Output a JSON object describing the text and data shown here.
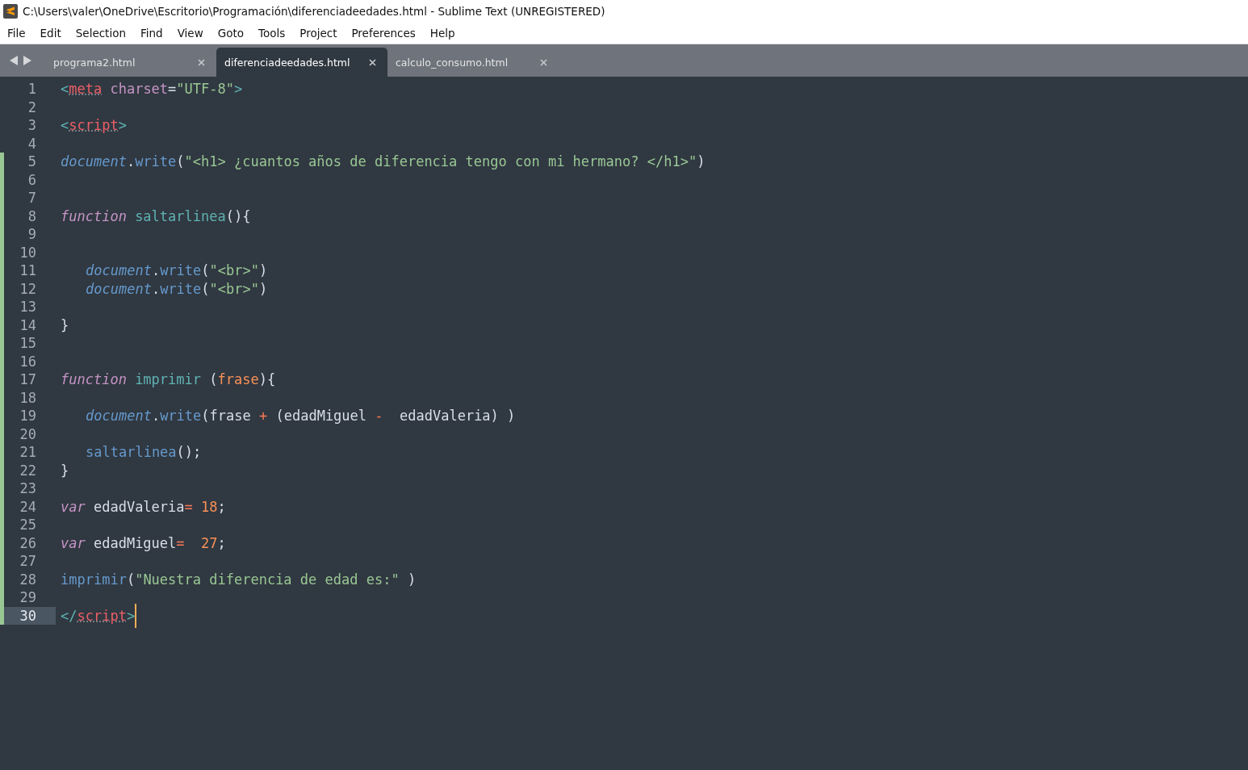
{
  "window": {
    "title": "C:\\Users\\valer\\OneDrive\\Escritorio\\Programación\\diferenciadeedades.html - Sublime Text (UNREGISTERED)"
  },
  "menu": [
    "File",
    "Edit",
    "Selection",
    "Find",
    "View",
    "Goto",
    "Tools",
    "Project",
    "Preferences",
    "Help"
  ],
  "tabs": [
    {
      "label": "programa2.html",
      "selected": false
    },
    {
      "label": "diferenciadeedades.html",
      "selected": true
    },
    {
      "label": "calculo_consumo.html",
      "selected": false
    }
  ],
  "lines": [
    {
      "number": "1",
      "modified": false,
      "current": false,
      "indented": false,
      "tokens": [
        {
          "kind": "tag",
          "text": "<"
        },
        {
          "kind": "tagname",
          "text": "meta"
        },
        {
          "kind": "attr",
          "text": " charset"
        },
        {
          "kind": "plain",
          "text": "="
        },
        {
          "kind": "string",
          "text": "\"UTF-8\""
        },
        {
          "kind": "tag",
          "text": ">"
        }
      ]
    },
    {
      "number": "2",
      "modified": false,
      "current": false,
      "indented": false
    },
    {
      "number": "3",
      "modified": false,
      "current": false,
      "indented": false,
      "tokens": [
        {
          "kind": "tag",
          "text": "<"
        },
        {
          "kind": "tagname",
          "text": "script"
        },
        {
          "kind": "tag",
          "text": ">"
        }
      ]
    },
    {
      "number": "4",
      "modified": false,
      "current": false,
      "indented": false
    },
    {
      "number": "5",
      "modified": true,
      "current": false,
      "indented": false,
      "tokens": [
        {
          "kind": "builtin",
          "text": "document"
        },
        {
          "kind": "plain",
          "text": "."
        },
        {
          "kind": "method",
          "text": "write"
        },
        {
          "kind": "plain",
          "text": "("
        },
        {
          "kind": "string",
          "text": "\"<h1> ¿cuantos años de diferencia tengo con mi hermano? </h1>\""
        },
        {
          "kind": "plain",
          "text": ")"
        }
      ]
    },
    {
      "number": "6",
      "modified": true,
      "current": false,
      "indented": false
    },
    {
      "number": "7",
      "modified": true,
      "current": false,
      "indented": false
    },
    {
      "number": "8",
      "modified": true,
      "current": false,
      "indented": false,
      "tokens": [
        {
          "kind": "keyword",
          "text": "function"
        },
        {
          "kind": "func",
          "text": " saltarlinea"
        },
        {
          "kind": "plain",
          "text": "(){"
        }
      ]
    },
    {
      "number": "9",
      "modified": true,
      "current": false,
      "indented": false
    },
    {
      "number": "10",
      "modified": true,
      "current": false,
      "indented": false
    },
    {
      "number": "11",
      "modified": true,
      "current": false,
      "indented": true,
      "tokens": [
        {
          "kind": "builtin",
          "text": "document"
        },
        {
          "kind": "plain",
          "text": "."
        },
        {
          "kind": "method",
          "text": "write"
        },
        {
          "kind": "plain",
          "text": "("
        },
        {
          "kind": "string",
          "text": "\"<br>\""
        },
        {
          "kind": "plain",
          "text": ")"
        }
      ]
    },
    {
      "number": "12",
      "modified": true,
      "current": false,
      "indented": true,
      "tokens": [
        {
          "kind": "builtin",
          "text": "document"
        },
        {
          "kind": "plain",
          "text": "."
        },
        {
          "kind": "method",
          "text": "write"
        },
        {
          "kind": "plain",
          "text": "("
        },
        {
          "kind": "string",
          "text": "\"<br>\""
        },
        {
          "kind": "plain",
          "text": ")"
        }
      ]
    },
    {
      "number": "13",
      "modified": true,
      "current": false,
      "indented": false
    },
    {
      "number": "14",
      "modified": true,
      "current": false,
      "indented": false,
      "tokens": [
        {
          "kind": "plain",
          "text": "}"
        }
      ]
    },
    {
      "number": "15",
      "modified": true,
      "current": false,
      "indented": false
    },
    {
      "number": "16",
      "modified": true,
      "current": false,
      "indented": false
    },
    {
      "number": "17",
      "modified": true,
      "current": false,
      "indented": false,
      "tokens": [
        {
          "kind": "keyword",
          "text": "function"
        },
        {
          "kind": "func",
          "text": " imprimir"
        },
        {
          "kind": "plain",
          "text": " ("
        },
        {
          "kind": "param",
          "text": "frase"
        },
        {
          "kind": "plain",
          "text": "){"
        }
      ]
    },
    {
      "number": "18",
      "modified": true,
      "current": false,
      "indented": false
    },
    {
      "number": "19",
      "modified": true,
      "current": false,
      "indented": true,
      "tokens": [
        {
          "kind": "builtin",
          "text": "document"
        },
        {
          "kind": "plain",
          "text": "."
        },
        {
          "kind": "method",
          "text": "write"
        },
        {
          "kind": "plain",
          "text": "(frase "
        },
        {
          "kind": "operator",
          "text": "+"
        },
        {
          "kind": "plain",
          "text": " (edadMiguel "
        },
        {
          "kind": "operator",
          "text": "-"
        },
        {
          "kind": "plain",
          "text": "  edadValeria) )"
        }
      ]
    },
    {
      "number": "20",
      "modified": true,
      "current": false,
      "indented": false
    },
    {
      "number": "21",
      "modified": true,
      "current": false,
      "indented": true,
      "tokens": [
        {
          "kind": "method",
          "text": "saltarlinea"
        },
        {
          "kind": "plain",
          "text": "();"
        }
      ]
    },
    {
      "number": "22",
      "modified": true,
      "current": false,
      "indented": false,
      "tokens": [
        {
          "kind": "plain",
          "text": "}"
        }
      ]
    },
    {
      "number": "23",
      "modified": true,
      "current": false,
      "indented": false
    },
    {
      "number": "24",
      "modified": true,
      "current": false,
      "indented": false,
      "tokens": [
        {
          "kind": "keyword",
          "text": "var"
        },
        {
          "kind": "plain",
          "text": " edadValeria"
        },
        {
          "kind": "operator",
          "text": "="
        },
        {
          "kind": "number",
          "text": " 18"
        },
        {
          "kind": "plain",
          "text": ";"
        }
      ]
    },
    {
      "number": "25",
      "modified": true,
      "current": false,
      "indented": false
    },
    {
      "number": "26",
      "modified": true,
      "current": false,
      "indented": false,
      "tokens": [
        {
          "kind": "keyword",
          "text": "var"
        },
        {
          "kind": "plain",
          "text": " edadMiguel"
        },
        {
          "kind": "operator",
          "text": "="
        },
        {
          "kind": "number",
          "text": "  27"
        },
        {
          "kind": "plain",
          "text": ";"
        }
      ]
    },
    {
      "number": "27",
      "modified": true,
      "current": false,
      "indented": false
    },
    {
      "number": "28",
      "modified": true,
      "current": false,
      "indented": false,
      "tokens": [
        {
          "kind": "method",
          "text": "imprimir"
        },
        {
          "kind": "plain",
          "text": "("
        },
        {
          "kind": "string",
          "text": "\"Nuestra diferencia de edad es:\""
        },
        {
          "kind": "plain",
          "text": " )"
        }
      ]
    },
    {
      "number": "29",
      "modified": true,
      "current": false,
      "indented": false
    },
    {
      "number": "30",
      "modified": true,
      "current": true,
      "indented": false,
      "tokens": [
        {
          "kind": "tag",
          "text": "</"
        },
        {
          "kind": "tagname",
          "text": "script"
        },
        {
          "kind": "tag",
          "text": ">"
        }
      ]
    }
  ]
}
